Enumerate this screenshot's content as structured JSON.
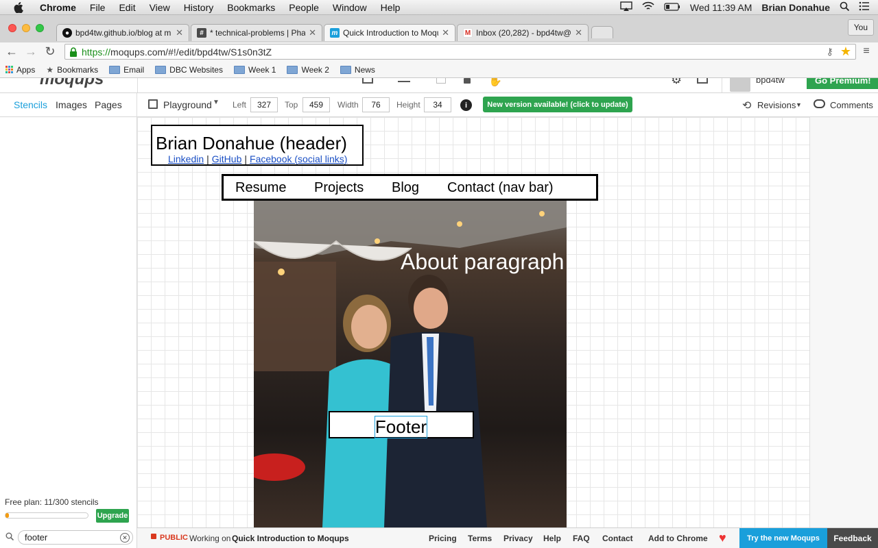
{
  "mac_menubar": {
    "app": "Chrome",
    "menus": [
      "File",
      "Edit",
      "View",
      "History",
      "Bookmarks",
      "People",
      "Window",
      "Help"
    ],
    "clock": "Wed 11:39 AM",
    "user": "Brian Donahue"
  },
  "tabs": [
    {
      "title": "bpd4tw.github.io/blog at m",
      "icon": "github-icon"
    },
    {
      "title": "* technical-problems | Pha",
      "icon": "hash-icon"
    },
    {
      "title": "Quick Introduction to Moqu",
      "icon": "moqups-icon"
    },
    {
      "title": "Inbox (20,282) - bpd4tw@",
      "icon": "gmail-icon"
    }
  ],
  "profile_button": "You",
  "address": {
    "scheme": "https://",
    "rest": "moqups.com/#!/edit/bpd4tw/S1s0n3tZ"
  },
  "bookmarks": [
    "Apps",
    "Bookmarks",
    "Email",
    "DBC Websites",
    "Week 1",
    "Week 2",
    "News"
  ],
  "app_top": {
    "logo": "moqups",
    "username": "bpd4tw",
    "go_premium": "Go Premium!"
  },
  "sidebar": {
    "tabs": [
      "Stencils",
      "Images",
      "Pages"
    ],
    "plan_text": "Free plan: 11/300 stencils",
    "plan_progress": 0.037,
    "upgrade": "Upgrade",
    "search_value": "footer"
  },
  "props": {
    "page": "Playground",
    "left_label": "Left",
    "left": "327",
    "top_label": "Top",
    "top": "459",
    "width_label": "Width",
    "width": "76",
    "height_label": "Height",
    "height": "34",
    "update": "New version available! (click to update)",
    "revisions": "Revisions",
    "comments": "Comments"
  },
  "mockup": {
    "header_title": "Brian Donahue (header)",
    "links": [
      "Linkedin",
      "GitHub",
      "Facebook (social links)"
    ],
    "sep": "|",
    "nav": [
      "Resume",
      "Projects",
      "Blog",
      "Contact (nav bar)"
    ],
    "about": "About paragraph",
    "footer": "Footer"
  },
  "bottom": {
    "public": "PUBLIC",
    "working_on": "Working on",
    "project": "Quick Introduction to Moqups",
    "links": [
      "Pricing",
      "Terms",
      "Privacy",
      "Help",
      "FAQ",
      "Contact",
      "Add to Chrome"
    ],
    "try": "Try the new Moqups",
    "feedback": "Feedback"
  },
  "colors": {
    "accent": "#2ea44f",
    "blue": "#1a9fdb",
    "link": "#1a4fc4"
  }
}
